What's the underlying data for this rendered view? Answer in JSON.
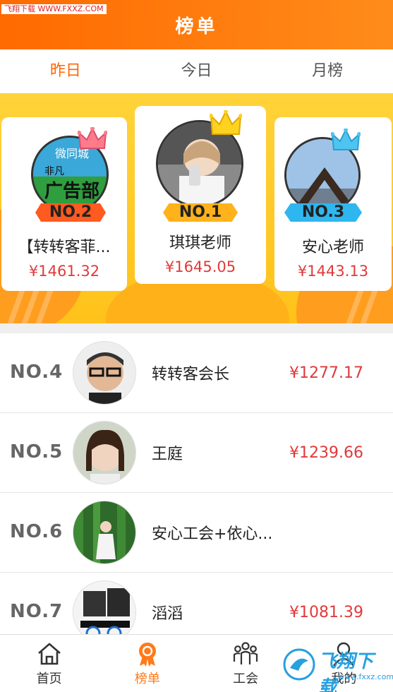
{
  "watermark_top": "飞翔下载 WWW.FXXZ.COM",
  "header": {
    "title": "榜单"
  },
  "tabs": [
    {
      "label": "昨日",
      "active": true
    },
    {
      "label": "今日",
      "active": false
    },
    {
      "label": "月榜",
      "active": false
    }
  ],
  "podium": {
    "left": {
      "rank": "NO.2",
      "name": "【转转客菲...",
      "amount": "¥1461.32",
      "avatar_text": [
        "微同城",
        "非凡",
        "广告部"
      ]
    },
    "mid": {
      "rank": "NO.1",
      "name": "琪琪老师",
      "amount": "¥1645.05"
    },
    "right": {
      "rank": "NO.3",
      "name": "安心老师",
      "amount": "¥1443.13"
    }
  },
  "list": [
    {
      "rank": "NO.4",
      "name": "转转客会长",
      "amount": "¥1277.17"
    },
    {
      "rank": "NO.5",
      "name": "王庭",
      "amount": "¥1239.66"
    },
    {
      "rank": "NO.6",
      "name": "安心工会+依心...",
      "amount": ""
    },
    {
      "rank": "NO.7",
      "name": "滔滔",
      "amount": "¥1081.39"
    }
  ],
  "bottom_nav": [
    {
      "label": "首页",
      "icon": "home-icon",
      "active": false
    },
    {
      "label": "榜单",
      "icon": "medal-icon",
      "active": true
    },
    {
      "label": "工会",
      "icon": "group-icon",
      "active": false
    },
    {
      "label": "我的",
      "icon": "user-icon",
      "active": false
    }
  ],
  "watermark_bottom": {
    "text": "飞翔下载",
    "sub": "www.fxxz.com"
  },
  "colors": {
    "accent": "#ff6600",
    "amount": "#e03a3a",
    "podium_bg": "#ffc21a"
  }
}
